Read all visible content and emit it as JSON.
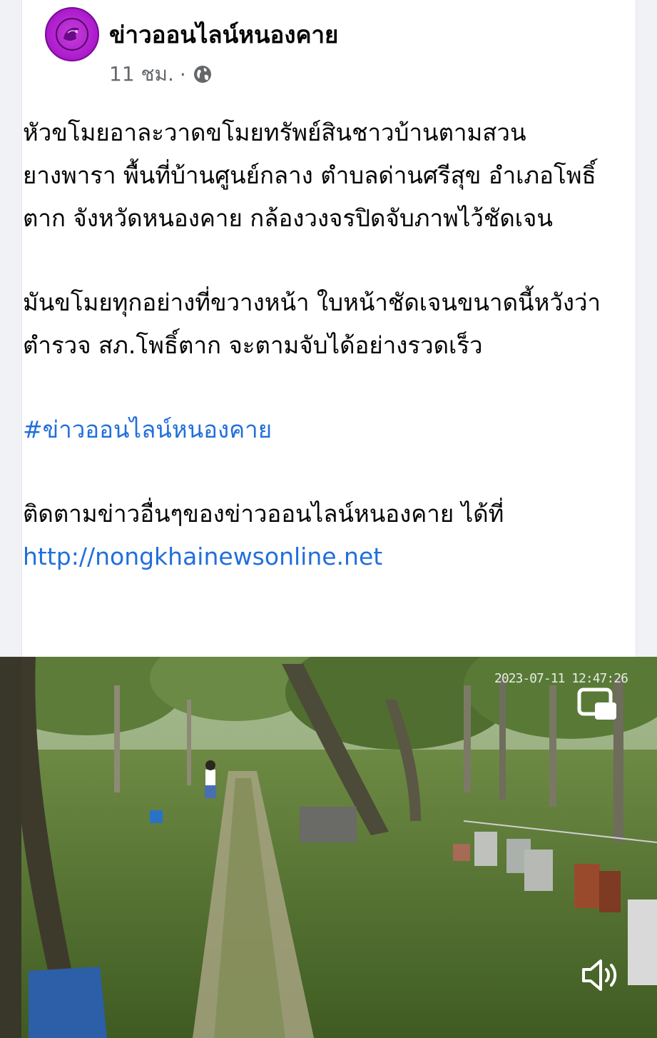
{
  "post": {
    "page_name": "ข่าวออนไลน์หนองคาย",
    "time_ago": "11 ชม.",
    "separator": "·",
    "audience_icon": "globe-icon",
    "paragraphs": [
      "หัวขโมยอาละวาดขโมยทรัพย์สินชาวบ้านตามสวนยางพารา พื้นที่บ้านศูนย์กลาง ตำบลด่านศรีสุข อำเภอโพธิ์ตาก จังหวัดหนองคาย กล้องวงจรปิดจับภาพไว้ชัดเจน",
      "มันขโมยทุกอย่างที่ขวางหน้า ใบหน้าชัดเจนขนาดนี้หวังว่าตำรวจ สภ.โพธิ์ตาก จะตามจับได้อย่างรวดเร็ว"
    ],
    "hashtag": "#ข่าวออนไลน์หนองคาย",
    "follow_text": "ติดตามข่าวอื่นๆของข่าวออนไลน์หนองคาย ได้ที่",
    "link": "http://nongkhainewsonline.net"
  },
  "video": {
    "cctv_timestamp": "2023-07-11 12:47:26",
    "pip_icon": "picture-in-picture-icon",
    "sound_icon": "speaker-icon"
  }
}
